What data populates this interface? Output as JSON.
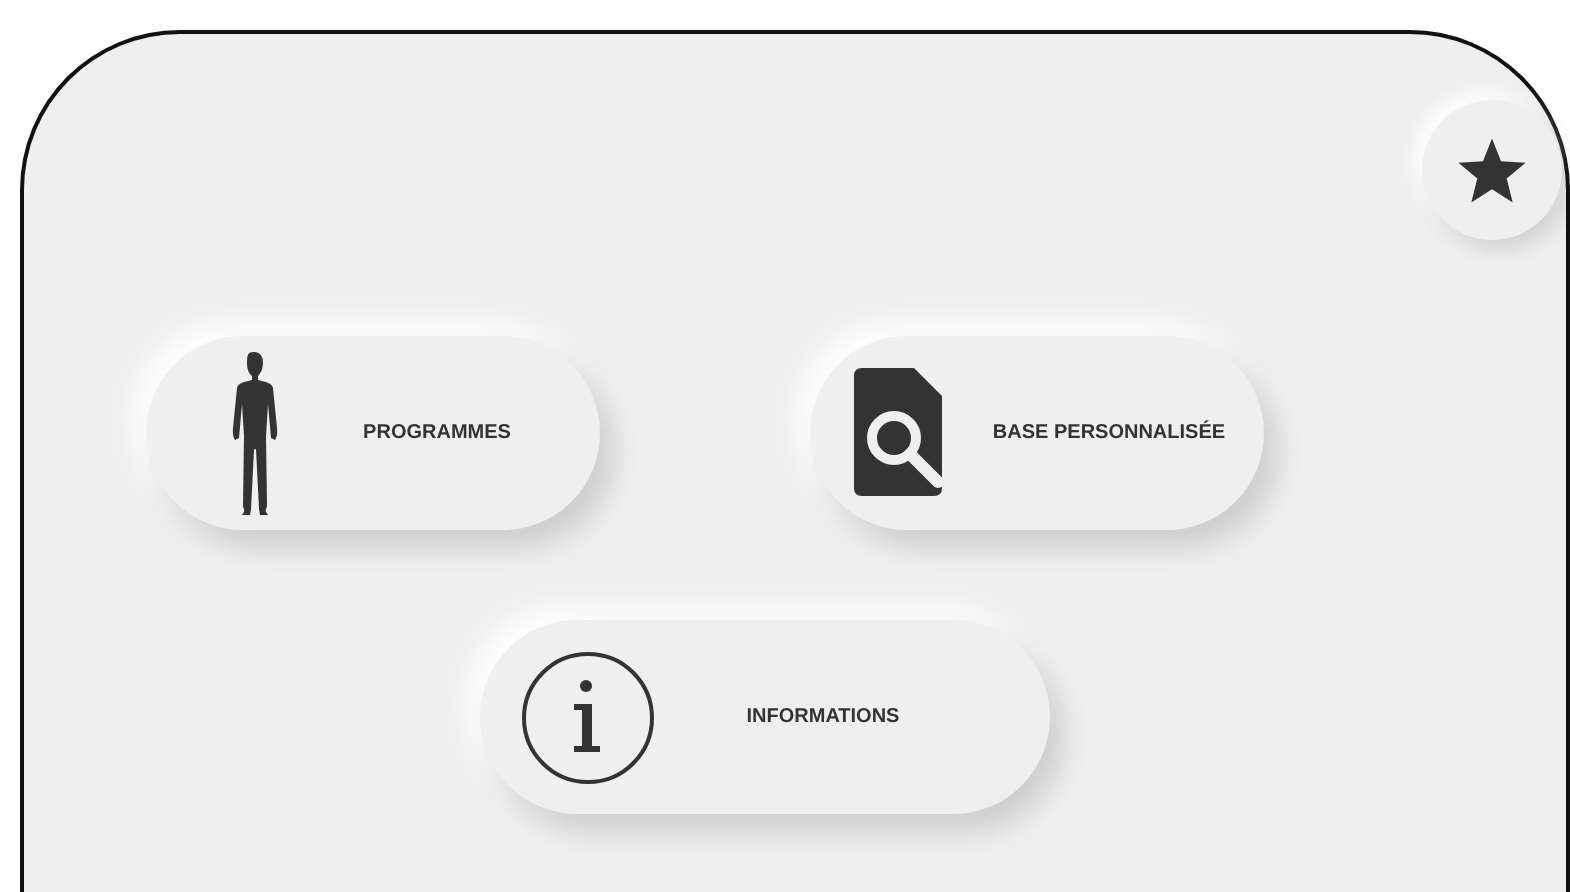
{
  "favorite_button": {
    "kind": "star"
  },
  "menu": [
    {
      "label": "PROGRAMMES",
      "kind": "body"
    },
    {
      "label": "BASE PERSONNALISÉE",
      "kind": "search-file"
    },
    {
      "label": "INFORMATIONS",
      "kind": "info"
    }
  ]
}
